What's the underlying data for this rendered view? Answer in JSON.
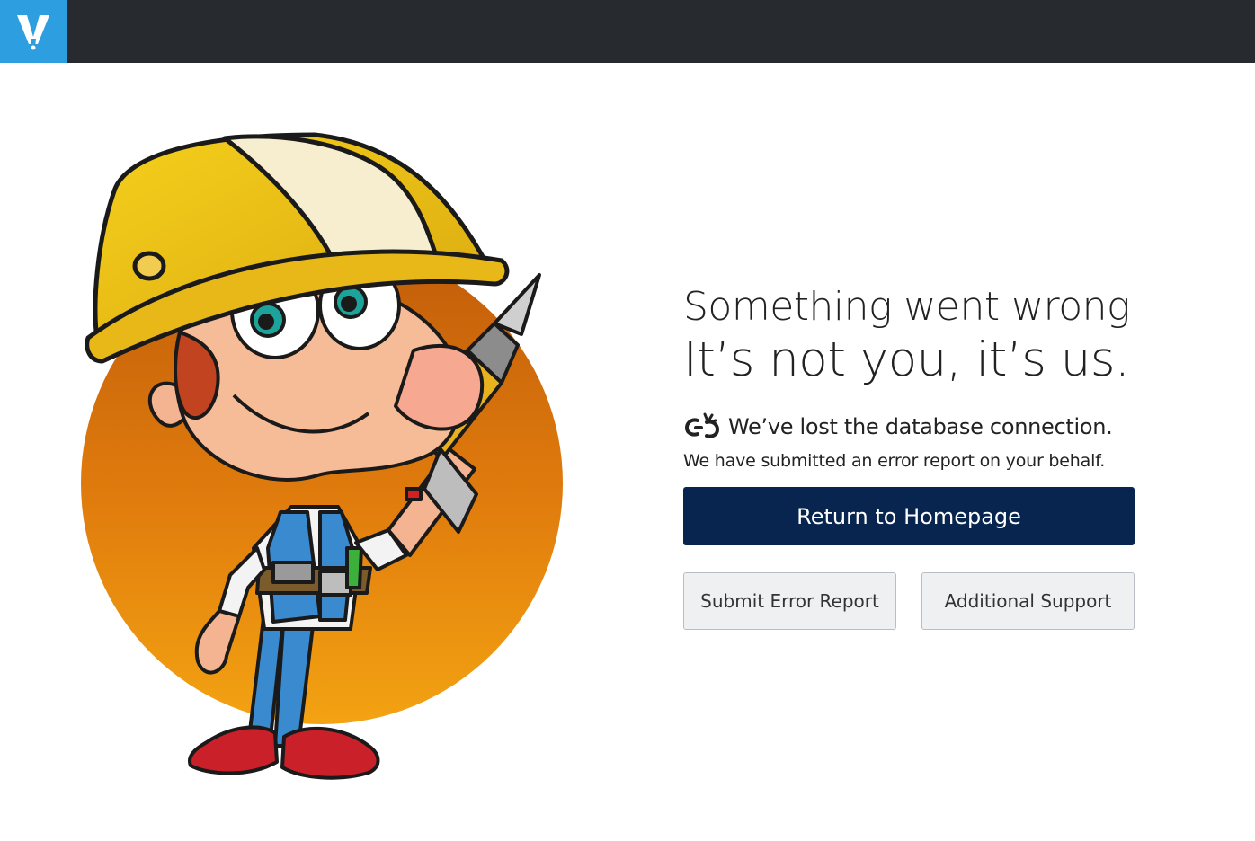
{
  "header": {
    "logo_icon": "v-logo-icon",
    "logo_color": "#2d9fe0",
    "bar_color": "#272b30"
  },
  "illustration": {
    "icon": "construction-worker-with-drill-illustration"
  },
  "error": {
    "title": "Something went wrong",
    "subtitle": "It’s not you, it’s us.",
    "connection_icon": "broken-link-icon",
    "message": "We’ve lost the database connection.",
    "report_note": "We have submitted an error report on your behalf."
  },
  "actions": {
    "primary_label": "Return to Homepage",
    "primary_color": "#07254f",
    "submit_label": "Submit Error Report",
    "support_label": "Additional Support"
  }
}
